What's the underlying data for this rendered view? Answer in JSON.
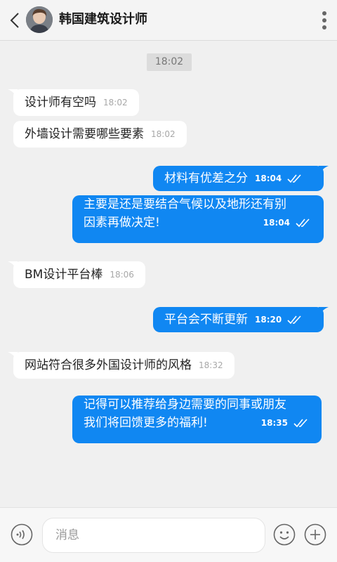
{
  "header": {
    "title": "韩国建筑设计师",
    "back_icon": "chevron-left-icon",
    "more_icon": "more-vertical-icon"
  },
  "divider_time": "18:02",
  "messages": [
    {
      "dir": "in",
      "text": "设计师有空吗",
      "time": "18:02"
    },
    {
      "dir": "in",
      "text": "外墙设计需要哪些要素",
      "time": "18:02"
    },
    {
      "dir": "out",
      "text": "材料有优差之分",
      "time": "18:04"
    },
    {
      "dir": "out",
      "line1": "主要是还是要结合气候以及地形还有别",
      "line2": "因素再做决定!",
      "time": "18:04"
    },
    {
      "dir": "in",
      "text": "BM设计平台棒",
      "time": "18:06"
    },
    {
      "dir": "out",
      "text": "平台会不断更新",
      "time": "18:20"
    },
    {
      "dir": "in",
      "text": "网站符合很多外国设计师的风格",
      "time": "18:32"
    },
    {
      "dir": "out",
      "line1": "记得可以推荐给身边需要的同事或朋友",
      "line2": "我们将回馈更多的福利!",
      "time": "18:35"
    }
  ],
  "composer": {
    "placeholder": "消息",
    "voice_icon": "voice-icon",
    "emoji_icon": "emoji-icon",
    "plus_icon": "plus-icon"
  },
  "colors": {
    "outgoing_bubble": "#1087f2",
    "incoming_bubble": "#ffffff",
    "background": "#f0f0f0"
  }
}
